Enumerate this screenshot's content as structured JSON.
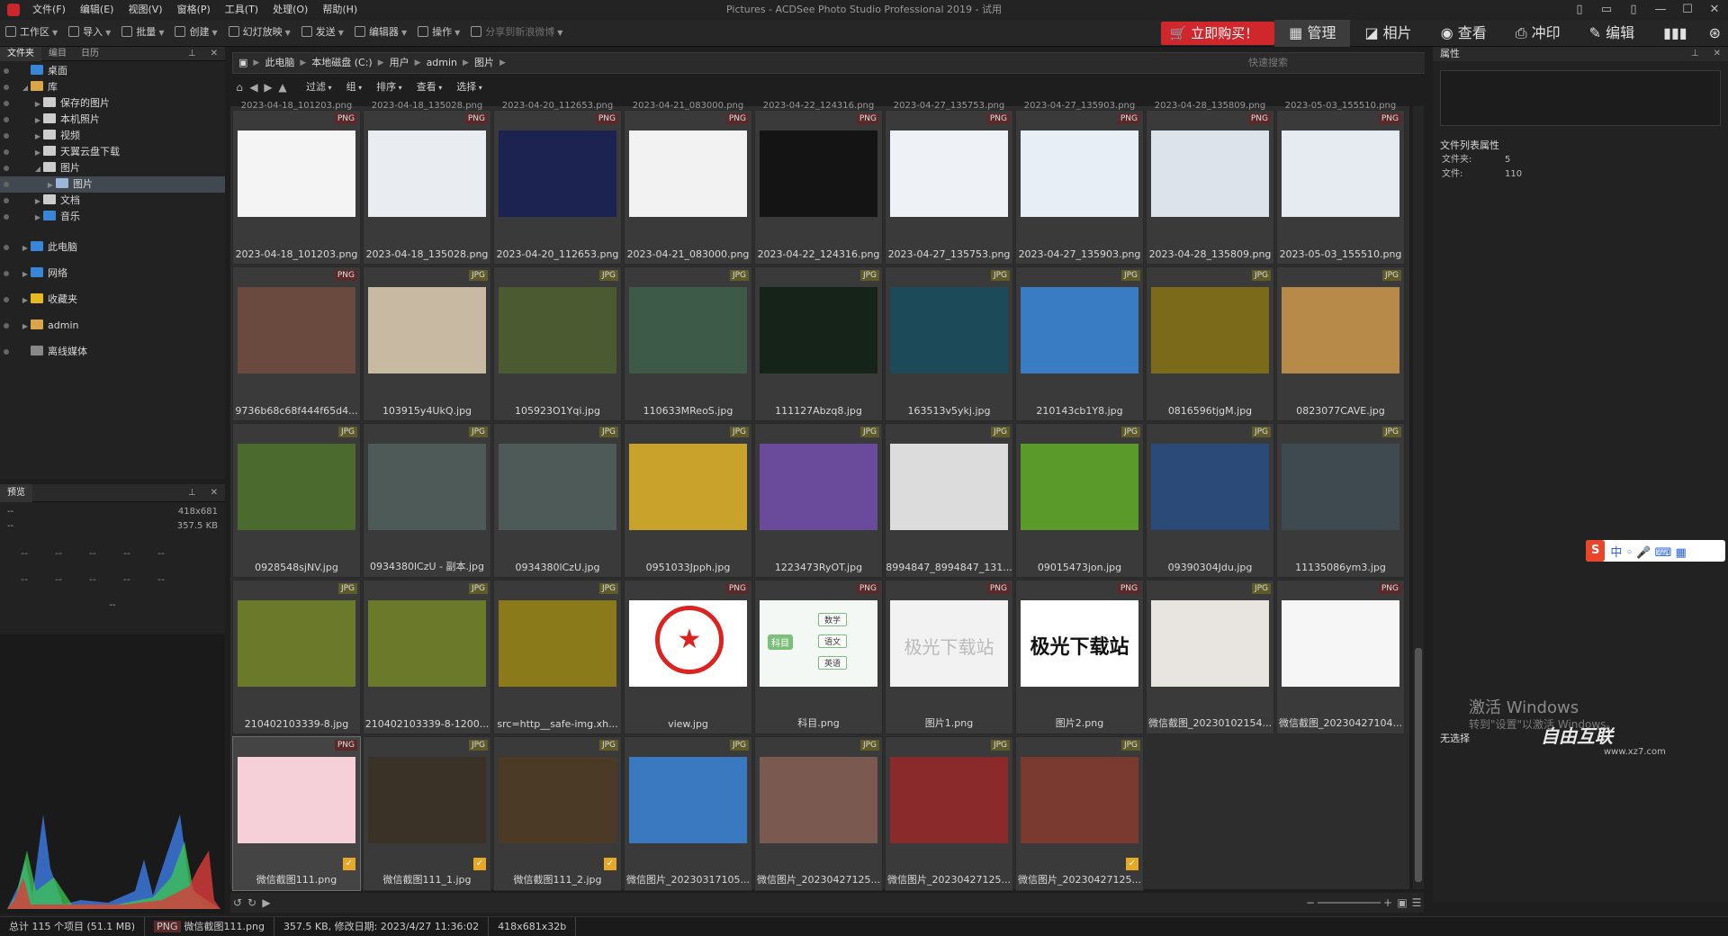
{
  "window_title": "Pictures - ACDSee Photo Studio Professional 2019 - 试用",
  "menu": [
    "文件(F)",
    "编辑(E)",
    "视图(V)",
    "窗格(P)",
    "工具(T)",
    "处理(O)",
    "帮助(H)"
  ],
  "toolbar": {
    "items": [
      "工作区",
      "导入",
      "批量",
      "创建",
      "幻灯放映",
      "发送",
      "编辑器",
      "操作"
    ],
    "share": "分享到新浪微博",
    "buy": "立即购买！",
    "modes": [
      "管理",
      "相片",
      "查看",
      "冲印",
      "编辑"
    ]
  },
  "left": {
    "tabs": [
      "文件夹",
      "编目",
      "日历"
    ],
    "tree": [
      {
        "label": "桌面",
        "level": 0,
        "color": "#3a86d6"
      },
      {
        "label": "库",
        "level": 0,
        "color": "#d9a64a"
      },
      {
        "label": "保存的图片",
        "level": 1,
        "color": "#cccccc"
      },
      {
        "label": "本机照片",
        "level": 1,
        "color": "#cccccc"
      },
      {
        "label": "视频",
        "level": 1,
        "color": "#cccccc"
      },
      {
        "label": "天翼云盘下载",
        "level": 1,
        "color": "#cccccc"
      },
      {
        "label": "图片",
        "level": 1,
        "color": "#cccccc"
      },
      {
        "label": "图片",
        "level": 2,
        "color": "#9ab6d8",
        "selected": true
      },
      {
        "label": "文档",
        "level": 1,
        "color": "#cccccc"
      },
      {
        "label": "音乐",
        "level": 1,
        "color": "#3a86d6"
      }
    ],
    "roots": [
      {
        "label": "此电脑",
        "color": "#3a86d6"
      },
      {
        "label": "网络",
        "color": "#3a86d6"
      },
      {
        "label": "收藏夹",
        "color": "#e8b820"
      },
      {
        "label": "admin",
        "color": "#d9a64a"
      },
      {
        "label": "离线媒体",
        "color": "#888888"
      }
    ]
  },
  "preview": {
    "title": "预览",
    "dims": "418x681",
    "size": "357.5 KB",
    "dash": "--",
    "grid_row": [
      "--",
      "--",
      "--",
      "--",
      "--"
    ]
  },
  "address": {
    "crumbs": [
      "此电脑",
      "本地磁盘 (C:)",
      "用户",
      "admin",
      "图片"
    ],
    "search_placeholder": "快速搜索"
  },
  "filter": [
    "过滤",
    "组",
    "排序",
    "查看",
    "选择"
  ],
  "partial_row": [
    "2023-04-18_101203.png",
    "2023-04-18_135028.png",
    "2023-04-20_112653.png",
    "2023-04-21_083000.png",
    "2023-04-22_124316.png",
    "2023-04-27_135753.png",
    "2023-04-27_135903.png",
    "2023-04-28_135809.png",
    "2023-05-03_155510.png"
  ],
  "thumbs": [
    [
      {
        "name": "2023-04-18_101203.png",
        "type": "PNG",
        "bg": "#f4f4f4"
      },
      {
        "name": "2023-04-18_135028.png",
        "type": "PNG",
        "bg": "#e9edf2"
      },
      {
        "name": "2023-04-20_112653.png",
        "type": "PNG",
        "bg": "#1c2350"
      },
      {
        "name": "2023-04-21_083000.png",
        "type": "PNG",
        "bg": "#f2f2f2"
      },
      {
        "name": "2023-04-22_124316.png",
        "type": "PNG",
        "bg": "#141414"
      },
      {
        "name": "2023-04-27_135753.png",
        "type": "PNG",
        "bg": "#eef2f7"
      },
      {
        "name": "2023-04-27_135903.png",
        "type": "PNG",
        "bg": "#e8eef5"
      },
      {
        "name": "2023-04-28_135809.png",
        "type": "PNG",
        "bg": "#dde3ea"
      },
      {
        "name": "2023-05-03_155510.png",
        "type": "PNG",
        "bg": "#e6ebf1"
      }
    ],
    [
      {
        "name": "9736b68c68f444f65d4...",
        "type": "PNG",
        "bg": "#6a4a3e"
      },
      {
        "name": "103915y4UkQ.jpg",
        "type": "JPG",
        "bg": "#c8b9a2"
      },
      {
        "name": "105923O1Yqi.jpg",
        "type": "JPG",
        "bg": "#4c5a32"
      },
      {
        "name": "110633MReoS.jpg",
        "type": "JPG",
        "bg": "#3d5a48"
      },
      {
        "name": "111127Abzq8.jpg",
        "type": "JPG",
        "bg": "#152318"
      },
      {
        "name": "163513v5ykj.jpg",
        "type": "JPG",
        "bg": "#1d4a58"
      },
      {
        "name": "210143cb1Y8.jpg",
        "type": "JPG",
        "bg": "#3a7cc4"
      },
      {
        "name": "0816596tjgM.jpg",
        "type": "JPG",
        "bg": "#7a6a1a"
      },
      {
        "name": "0823077CAVE.jpg",
        "type": "JPG",
        "bg": "#b88a4a"
      }
    ],
    [
      {
        "name": "0928548sjNV.jpg",
        "type": "JPG",
        "bg": "#4a6a2e"
      },
      {
        "name": "0934380lCzU - 副本.jpg",
        "type": "JPG",
        "bg": "#4e5a58"
      },
      {
        "name": "0934380lCzU.jpg",
        "type": "JPG",
        "bg": "#4e5a58"
      },
      {
        "name": "0951033Jpph.jpg",
        "type": "JPG",
        "bg": "#c8a22a"
      },
      {
        "name": "1223473RyOT.jpg",
        "type": "JPG",
        "bg": "#6a4a9a"
      },
      {
        "name": "8994847_8994847_131...",
        "type": "JPG",
        "bg": "#dcdcdc"
      },
      {
        "name": "09015473jon.jpg",
        "type": "JPG",
        "bg": "#5a9a2a"
      },
      {
        "name": "09390304Jdu.jpg",
        "type": "JPG",
        "bg": "#2c4a78"
      },
      {
        "name": "11135086ym3.jpg",
        "type": "JPG",
        "bg": "#3e4a50"
      }
    ],
    [
      {
        "name": "210402103339-8.jpg",
        "type": "JPG",
        "bg": "#6a7a2a"
      },
      {
        "name": "210402103339-8-1200...",
        "type": "JPG",
        "bg": "#6a7a2a"
      },
      {
        "name": "src=http__safe-img.xh...",
        "type": "JPG",
        "bg": "#8a7a1a"
      },
      {
        "name": "view.jpg",
        "type": "PNG",
        "bg": "#ffffff"
      },
      {
        "name": "科目.png",
        "type": "PNG",
        "bg": "#f4f8f4"
      },
      {
        "name": "图片1.png",
        "type": "PNG",
        "bg": "#f2f2f2"
      },
      {
        "name": "图片2.png",
        "type": "PNG",
        "bg": "#ffffff"
      },
      {
        "name": "微信截图_20230102154...",
        "type": "JPG",
        "bg": "#e8e4e0"
      },
      {
        "name": "微信截图_20230427104...",
        "type": "PNG",
        "bg": "#f6f6f6"
      }
    ],
    [
      {
        "name": "微信截图111.png",
        "type": "PNG",
        "bg": "#f6d0d8",
        "checked": true,
        "selected": true
      },
      {
        "name": "微信截图111_1.jpg",
        "type": "JPG",
        "bg": "#3a3226",
        "checked": true
      },
      {
        "name": "微信截图111_2.jpg",
        "type": "JPG",
        "bg": "#4a3a26",
        "checked": true
      },
      {
        "name": "微信图片_20230317105...",
        "type": "JPG",
        "bg": "#3a78c0"
      },
      {
        "name": "微信图片_20230427125...",
        "type": "JPG",
        "bg": "#7a5a50"
      },
      {
        "name": "微信图片_20230427125...",
        "type": "JPG",
        "bg": "#8a2a2a"
      },
      {
        "name": "微信图片_20230427125...",
        "type": "JPG",
        "bg": "#7a3a30",
        "checked": true
      }
    ]
  ],
  "thumb_text": {
    "tu1": "极光下载站",
    "tu2": "极光下载站",
    "km_root": "科目",
    "km_items": [
      "数学",
      "语文",
      "英语"
    ]
  },
  "properties": {
    "title": "属性",
    "list_title": "文件列表属性",
    "folders_label": "文件夹:",
    "folders_value": "5",
    "files_label": "文件:",
    "files_value": "110",
    "no_selection": "无选择"
  },
  "watermark": {
    "line1": "激活 Windows",
    "line2": "转到\"设置\"以激活 Windows。",
    "logo": "自由互联",
    "url": "www.xz7.com"
  },
  "status": {
    "total": "总计 115 个项目 (51.1 MB)",
    "type": "PNG",
    "file": "微信截图111.png",
    "meta": "357.5 KB, 修改日期: 2023/4/27 11:36:02",
    "dims": "418x681x32b"
  }
}
